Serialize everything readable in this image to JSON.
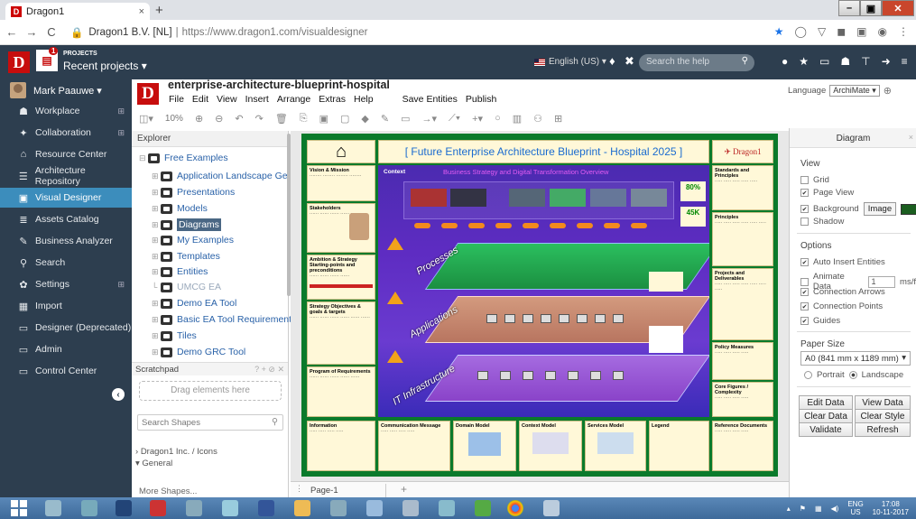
{
  "browser": {
    "tab_title": "Dragon1",
    "favicon": "D",
    "tab_close": "×",
    "new_tab": "+",
    "url_site": "Dragon1 B.V. [NL]",
    "url_sep": "|",
    "url_full": "https://www.dragon1.com/visualdesigner",
    "win_min": "–",
    "win_max": "▣",
    "win_close": "✕"
  },
  "topbar": {
    "logo": "D",
    "projects_label": "PROJECTS",
    "projects_badge": "1",
    "recent": "Recent projects ▾",
    "language": "English (US) ▾",
    "search_placeholder": "Search the help"
  },
  "sidebar": {
    "user": "Mark Paauwe ▾",
    "items": [
      {
        "label": "Workplace",
        "icon": "☗",
        "expand": "⊞"
      },
      {
        "label": "Collaboration",
        "icon": "✦",
        "expand": "⊞"
      },
      {
        "label": "Resource Center",
        "icon": "⌂"
      },
      {
        "label": "Architecture Repository",
        "icon": "☰"
      },
      {
        "label": "Visual Designer",
        "icon": "▣"
      },
      {
        "label": "Assets Catalog",
        "icon": "≣"
      },
      {
        "label": "Business Analyzer",
        "icon": "✎"
      },
      {
        "label": "Search",
        "icon": "⚲"
      },
      {
        "label": "Settings",
        "icon": "✿",
        "expand": "⊞"
      },
      {
        "label": "Import",
        "icon": "▦"
      },
      {
        "label": "Designer (Deprecated)",
        "icon": "▭"
      },
      {
        "label": "Admin",
        "icon": "▭"
      },
      {
        "label": "Control Center",
        "icon": "▭"
      }
    ],
    "collapse": "‹"
  },
  "app": {
    "logo": "D",
    "title": "enterprise-architecture-blueprint-hospital",
    "menu": [
      "File",
      "Edit",
      "View",
      "Insert",
      "Arrange",
      "Extras",
      "Help"
    ],
    "menu_actions": [
      "Save Entities",
      "Publish"
    ],
    "language_label": "Language",
    "language_value": "ArchiMate ▾"
  },
  "toolbar": {
    "zoom": "10%"
  },
  "explorer": {
    "title": "Explorer",
    "root": "Free Examples",
    "items": [
      "Application Landscape Genera",
      "Presentations",
      "Models",
      "Diagrams",
      "My Examples",
      "Templates",
      "Entities",
      "UMCG EA",
      "Demo EA Tool",
      "Basic EA Tool Requirements",
      "Tiles",
      "Demo GRC Tool"
    ]
  },
  "scratchpad": {
    "title": "Scratchpad",
    "controls": "? + ⊘ ✕",
    "drop": "Drag elements here",
    "search_placeholder": "Search Shapes",
    "lib": "Dragon1 Inc. / Icons",
    "general": "General",
    "more": "More Shapes..."
  },
  "diagram": {
    "title": "[ Future Enterprise Architecture Blueprint - Hospital 2025 ]",
    "brand": "Dragon1",
    "context": "Context",
    "strategy": "Business Strategy and Digital Transformation Overview",
    "layer_processes": "Processes",
    "layer_applications": "Applications",
    "layer_infra": "IT Infrastructure",
    "stat1": "80%",
    "stat2": "45K",
    "left_cells": [
      "Vision & Mission",
      "Stakeholders",
      "Ambition & Strategy Starting-points and preconditions",
      "Strategy Objectives & goals & targets",
      "Program of Requirements"
    ],
    "right_cells": [
      "Standards and Principles",
      "Principles",
      "Projects and Deliverables",
      "Policy Measures",
      "Core Figures / Complexity"
    ],
    "bottom_cells": [
      "Information",
      "Communication Message",
      "Domain Model",
      "Context Model",
      "Services Model",
      "Legend",
      "Reference Documents"
    ]
  },
  "pages": {
    "menu": "⋮",
    "tab": "Page-1",
    "add": "+"
  },
  "right_panel": {
    "title": "Diagram",
    "close": "×",
    "view_label": "View",
    "grid": "Grid",
    "page_view": "Page View",
    "background": "Background",
    "image_btn": "Image",
    "shadow": "Shadow",
    "options_label": "Options",
    "auto_insert": "Auto Insert Entities",
    "animate": "Animate Data",
    "animate_value": "1",
    "animate_unit": "ms/f",
    "conn_arrows": "Connection Arrows",
    "conn_points": "Connection Points",
    "guides": "Guides",
    "paper_label": "Paper Size",
    "paper_value": "A0 (841 mm x 1189 mm)",
    "portrait": "Portrait",
    "landscape": "Landscape",
    "buttons": [
      "Edit Data",
      "View Data",
      "Clear Data",
      "Clear Style",
      "Validate",
      "Refresh"
    ],
    "bg_color": "#1b5e20"
  },
  "taskbar": {
    "lang": "ENG",
    "region": "US",
    "time": "17:08",
    "date": "10-11-2017"
  }
}
